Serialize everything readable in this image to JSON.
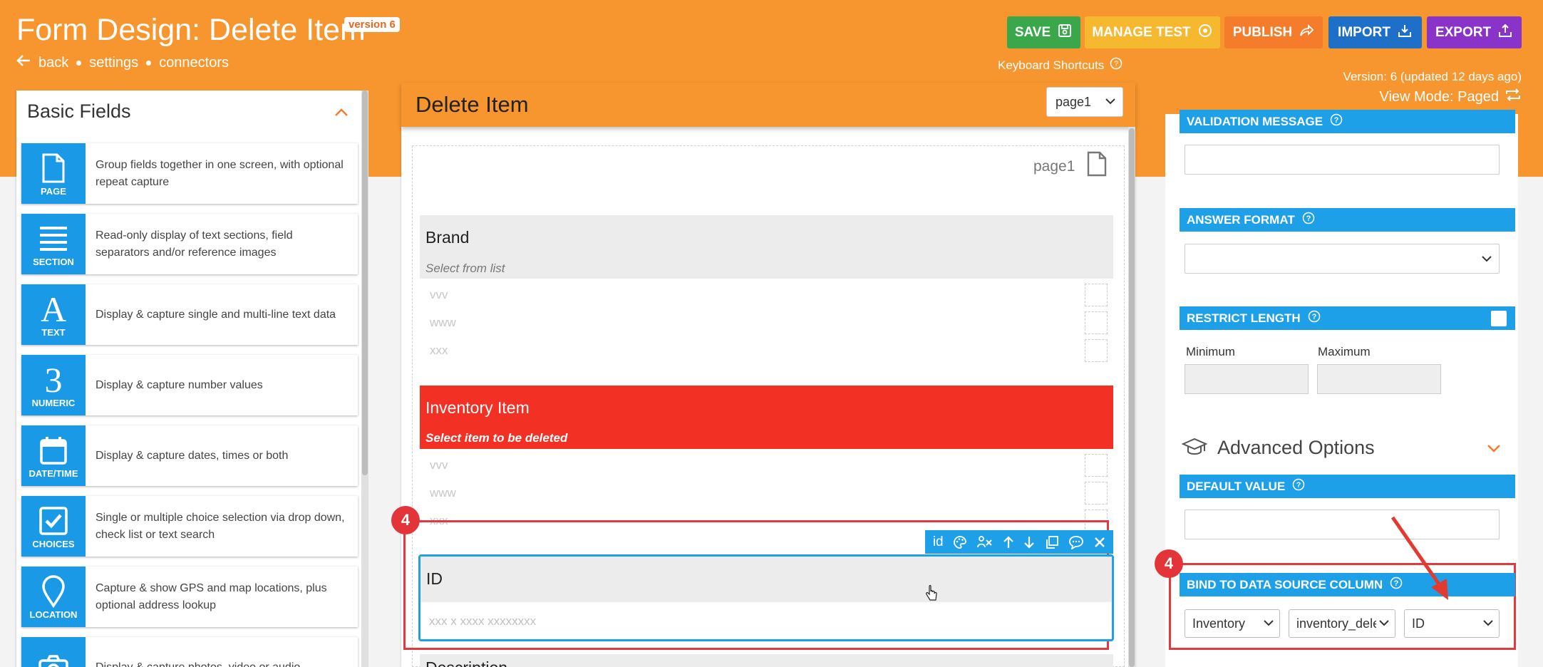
{
  "header": {
    "title": "Form Design: Delete Item",
    "version_badge": "version 6",
    "nav": {
      "back": "back",
      "settings": "settings",
      "connectors": "connectors"
    },
    "buttons": {
      "save": "SAVE",
      "manage_test": "MANAGE TEST",
      "publish": "PUBLISH",
      "import": "IMPORT",
      "export": "EXPORT"
    },
    "keyboard_shortcuts": "Keyboard Shortcuts",
    "version_info": "Version: 6 (updated 12 days ago)",
    "view_mode": "View Mode: Paged"
  },
  "colors": {
    "brand_orange": "#f7962f",
    "save_green": "#3aa84a",
    "manage_yellow": "#f5b82e",
    "publish_orange": "#f47c2a",
    "import_blue": "#1d6fc7",
    "export_purple": "#8a33c8",
    "accent_blue": "#1ea0e8",
    "error_red": "#f23023",
    "annotation_red": "#e0393e"
  },
  "left_panel": {
    "title": "Basic Fields",
    "fields": [
      {
        "label": "PAGE",
        "icon": "page-icon",
        "description": "Group fields together in one screen, with optional repeat capture"
      },
      {
        "label": "SECTION",
        "icon": "section-icon",
        "description": "Read-only display of text sections, field separators and/or reference images"
      },
      {
        "label": "TEXT",
        "icon": "text-icon",
        "glyph": "A",
        "description": "Display & capture single and multi-line text data"
      },
      {
        "label": "NUMERIC",
        "icon": "numeric-icon",
        "glyph": "3",
        "description": "Display & capture number values"
      },
      {
        "label": "DATE/TIME",
        "icon": "calendar-icon",
        "description": "Display & capture dates, times or both"
      },
      {
        "label": "CHOICES",
        "icon": "checkbox-icon",
        "description": "Single or multiple choice selection via drop down, check list or text search"
      },
      {
        "label": "LOCATION",
        "icon": "location-pin-icon",
        "description": "Capture & show GPS and map locations, plus optional address lookup"
      },
      {
        "label": "",
        "icon": "camera-icon",
        "description": "Display & capture photos, video or audio"
      }
    ]
  },
  "form": {
    "title": "Delete Item",
    "page_select": "page1",
    "page_label": "page1",
    "brand": {
      "title": "Brand",
      "subtitle": "Select from list",
      "options": [
        "vvv",
        "www",
        "xxx"
      ]
    },
    "inventory": {
      "title": "Inventory Item",
      "subtitle": "Select item to be deleted",
      "options": [
        "vvv",
        "www",
        "xxx"
      ]
    },
    "id_field": {
      "title": "ID",
      "placeholder": "xxx x xxxx xxxxxxxx",
      "toolbar_label": "id"
    },
    "annotation_number": "4",
    "next_field_partial": "Description"
  },
  "right_panel": {
    "validation_message": "VALIDATION MESSAGE",
    "answer_format": "ANSWER FORMAT",
    "restrict_length": "RESTRICT LENGTH",
    "minimum": "Minimum",
    "maximum": "Maximum",
    "advanced_options": "Advanced Options",
    "default_value": "DEFAULT VALUE",
    "bind_column": "BIND TO DATA SOURCE COLUMN",
    "bind_selects": [
      "Inventory",
      "inventory_delete",
      "ID"
    ],
    "annotation_number": "4"
  }
}
